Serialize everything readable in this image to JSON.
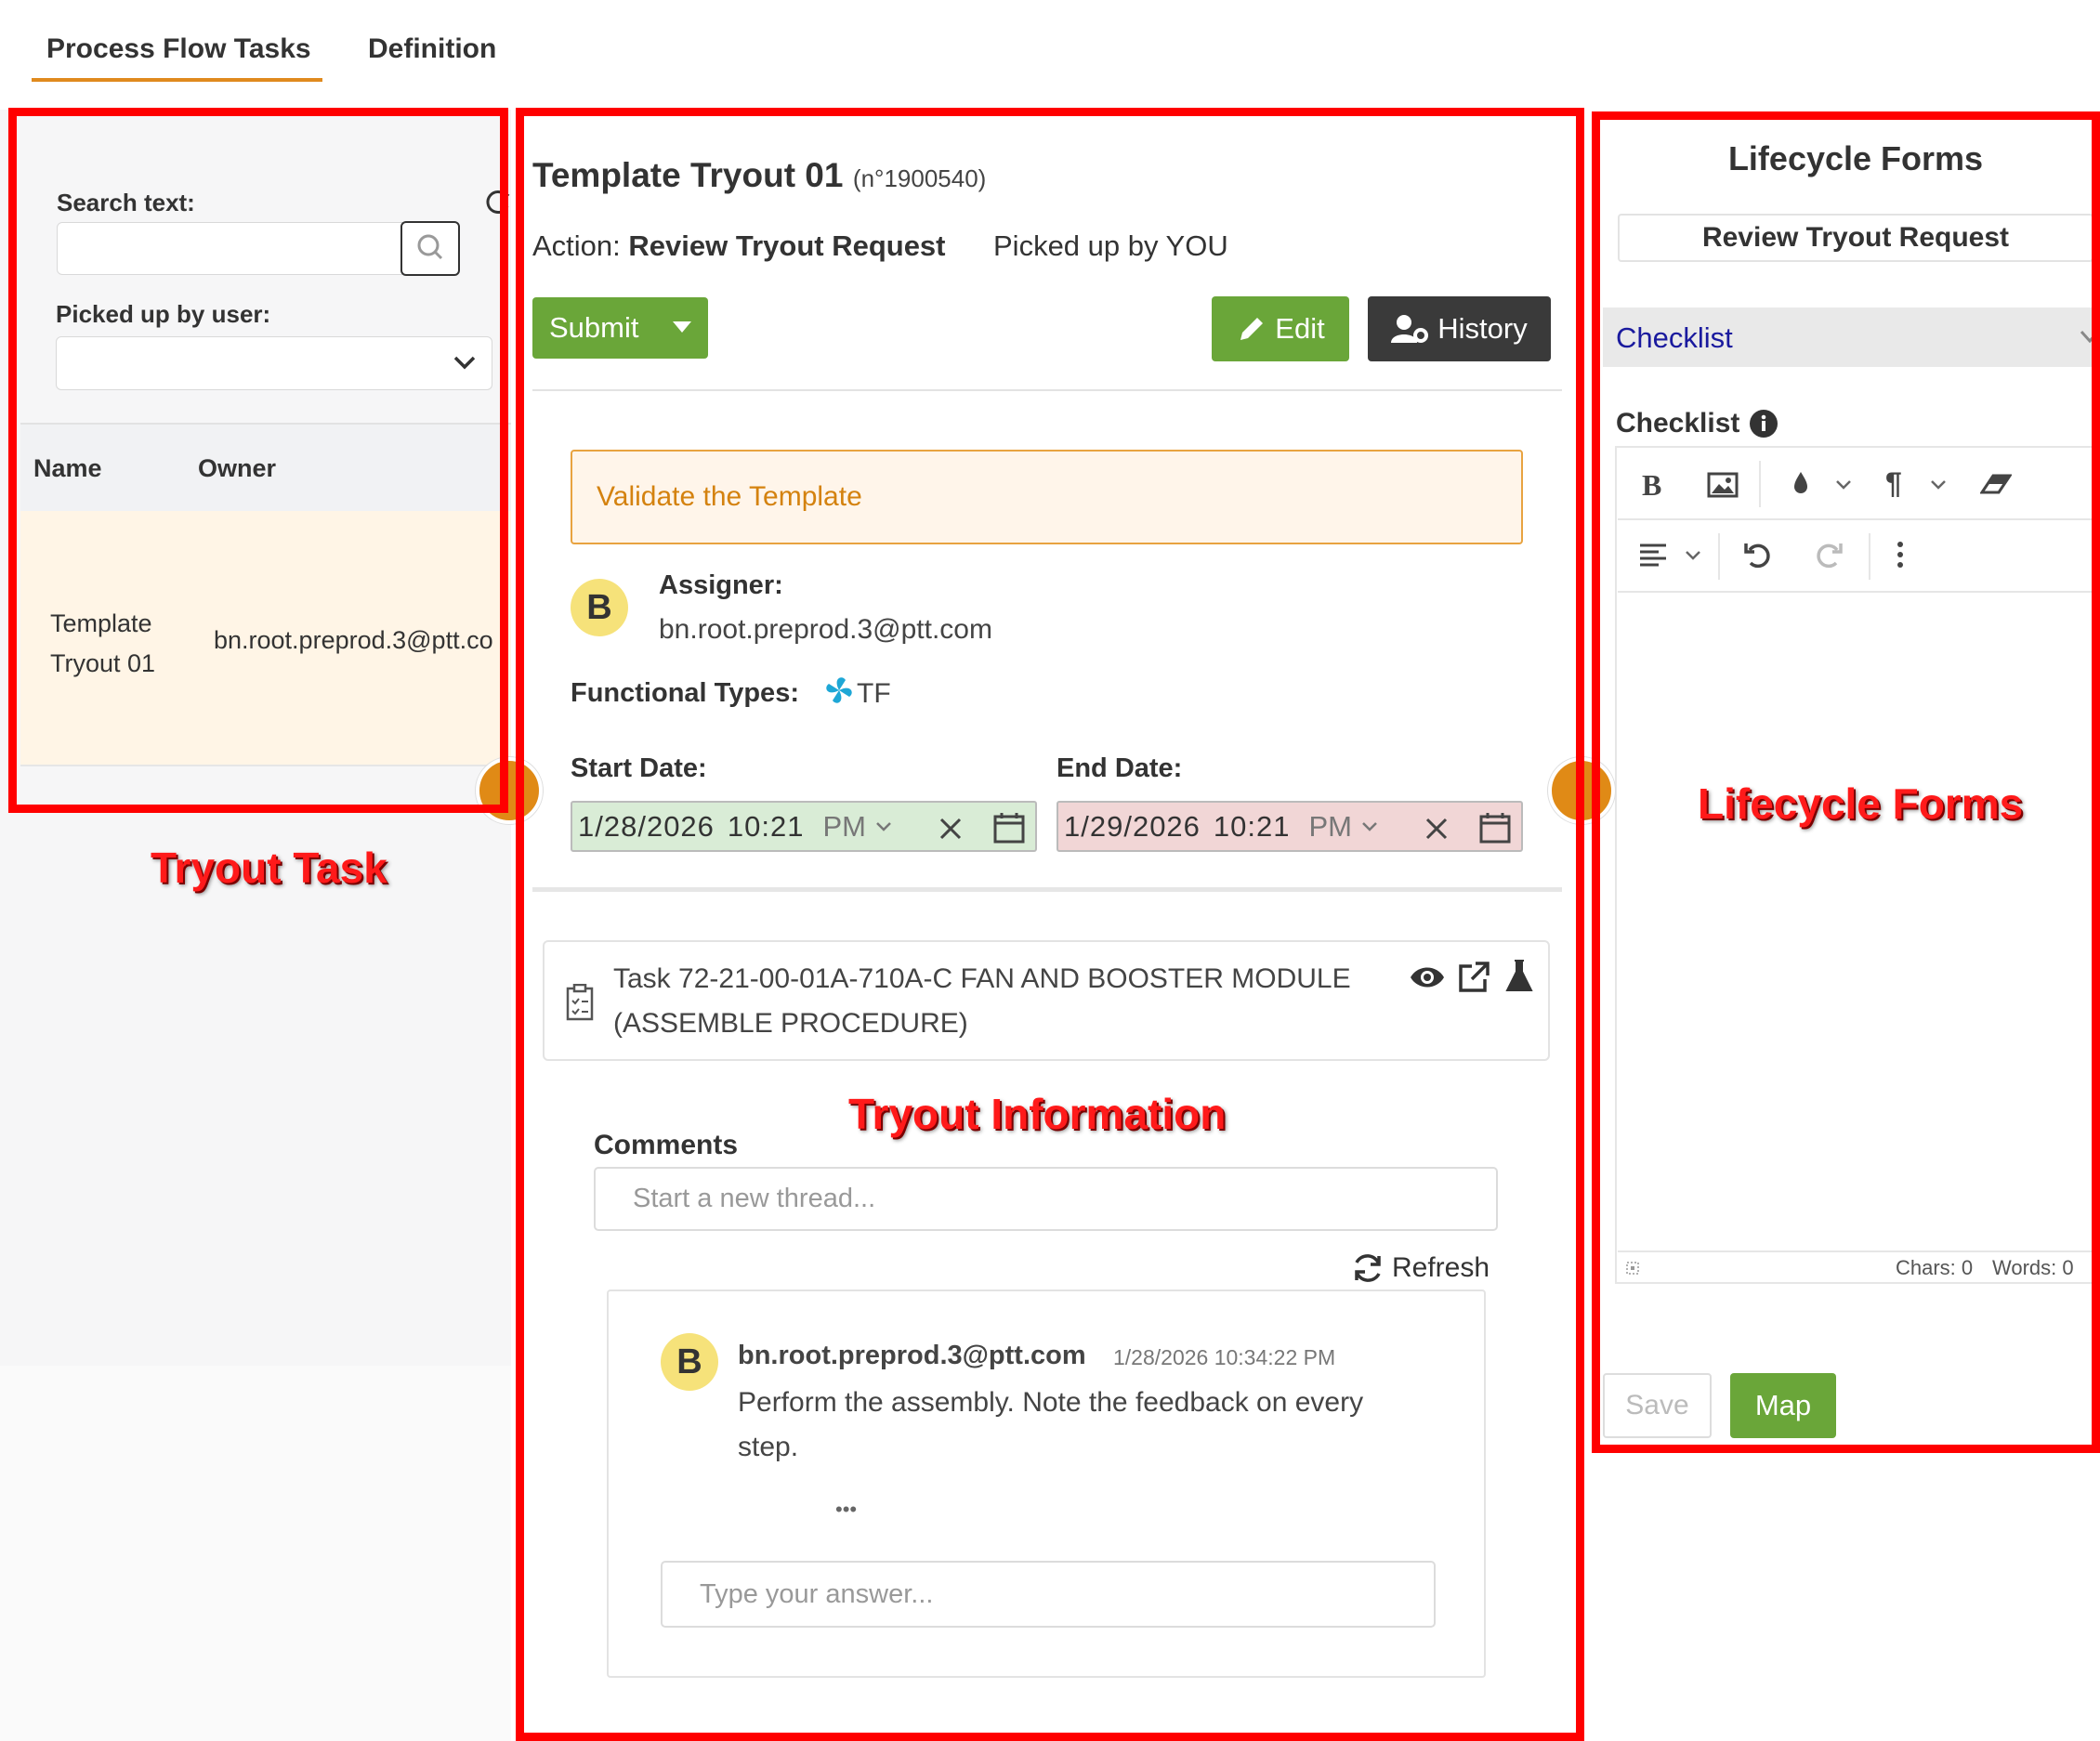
{
  "tabs": {
    "process_flow_tasks": "Process Flow Tasks",
    "definition": "Definition"
  },
  "filters": {
    "search_label": "Search text:",
    "search_value": "",
    "picked_label": "Picked up by user:",
    "picked_value": ""
  },
  "task_table": {
    "headers": {
      "name": "Name",
      "owner": "Owner"
    },
    "rows": [
      {
        "name_line1": "Template",
        "name_line2": "Tryout 01",
        "owner": "bn.root.preprod.3@ptt.co"
      }
    ]
  },
  "detail": {
    "title": "Template Tryout 01",
    "number": "(n°1900540)",
    "action_prefix": "Action:",
    "action_name": "Review Tryout Request",
    "picked_up": "Picked up by YOU",
    "submit_label": "Submit",
    "edit_label": "Edit",
    "history_label": "History",
    "alert_text": "Validate the Template",
    "assigner_initial": "B",
    "assigner_label": "Assigner:",
    "assigner_email": "bn.root.preprod.3@ptt.com",
    "functional_types_label": "Functional Types:",
    "functional_type": "TF",
    "start_label": "Start Date:",
    "start_date": "1/28/2026",
    "start_time": "10:21",
    "start_ampm": "PM",
    "end_label": "End Date:",
    "end_date": "1/29/2026",
    "end_time": "10:21",
    "end_ampm": "PM",
    "task_line1": "Task 72-21-00-01A-710A-C FAN AND BOOSTER MODULE",
    "task_line2": "(ASSEMBLE PROCEDURE)"
  },
  "comments": {
    "label": "Comments",
    "new_thread_placeholder": "Start a new thread...",
    "refresh_label": "Refresh",
    "thread": {
      "initial": "B",
      "author": "bn.root.preprod.3@ptt.com",
      "timestamp": "1/28/2026 10:34:22 PM",
      "text_line1": "Perform the assembly. Note the feedback on every",
      "text_line2": "step.",
      "more": "•••",
      "reply_placeholder": "Type your answer..."
    }
  },
  "lifecycle": {
    "title": "Lifecycle Forms",
    "form_name": "Review Tryout Request",
    "section": "Checklist",
    "field_label": "Checklist",
    "chars": "Chars: 0",
    "words": "Words: 0",
    "save_label": "Save",
    "map_label": "Map"
  },
  "annotations": {
    "left": "Tryout Task",
    "middle": "Tryout Information",
    "right": "Lifecycle Forms",
    "color": "#ff0000"
  },
  "colors": {
    "accent": "#e08a1e",
    "green": "#6aa639",
    "dark": "#3a3a3a",
    "link": "#1a1a9e"
  }
}
